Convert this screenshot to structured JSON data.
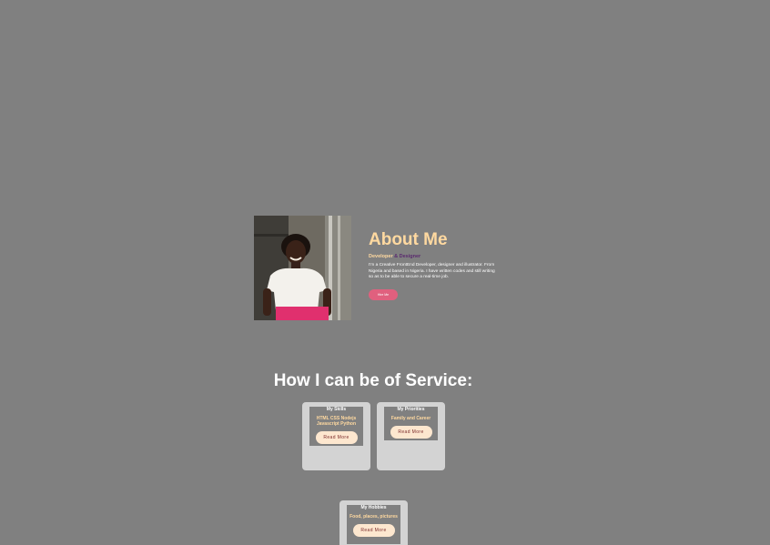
{
  "about": {
    "title": "About Me",
    "role_developer": "Developer",
    "role_designer": "& Designer",
    "description": "I'm a Creative FrontEnd Developer, designer and illustrator. From Nigeria and based in Nigeria. I have written codes and still writing so as to be able to secure a real-time job.",
    "hire_button": "Hire Me",
    "photo_alt": "portrait-photo"
  },
  "services": {
    "title": "How I can be of Service:",
    "cards": [
      {
        "title": "My Skills",
        "text": "HTML CSS Nodejs Javascript Python",
        "button": "Read More"
      },
      {
        "title": "My Priorities",
        "text": "Family and Career",
        "button": "Read More"
      },
      {
        "title": "My Hobbies",
        "text": "Food, places, pictures",
        "button": "Read More"
      }
    ]
  },
  "colors": {
    "background": "#808080",
    "accent_peach": "#ffd9a0",
    "button_pink": "#e0607e",
    "card_bg": "#d3d3d3"
  }
}
